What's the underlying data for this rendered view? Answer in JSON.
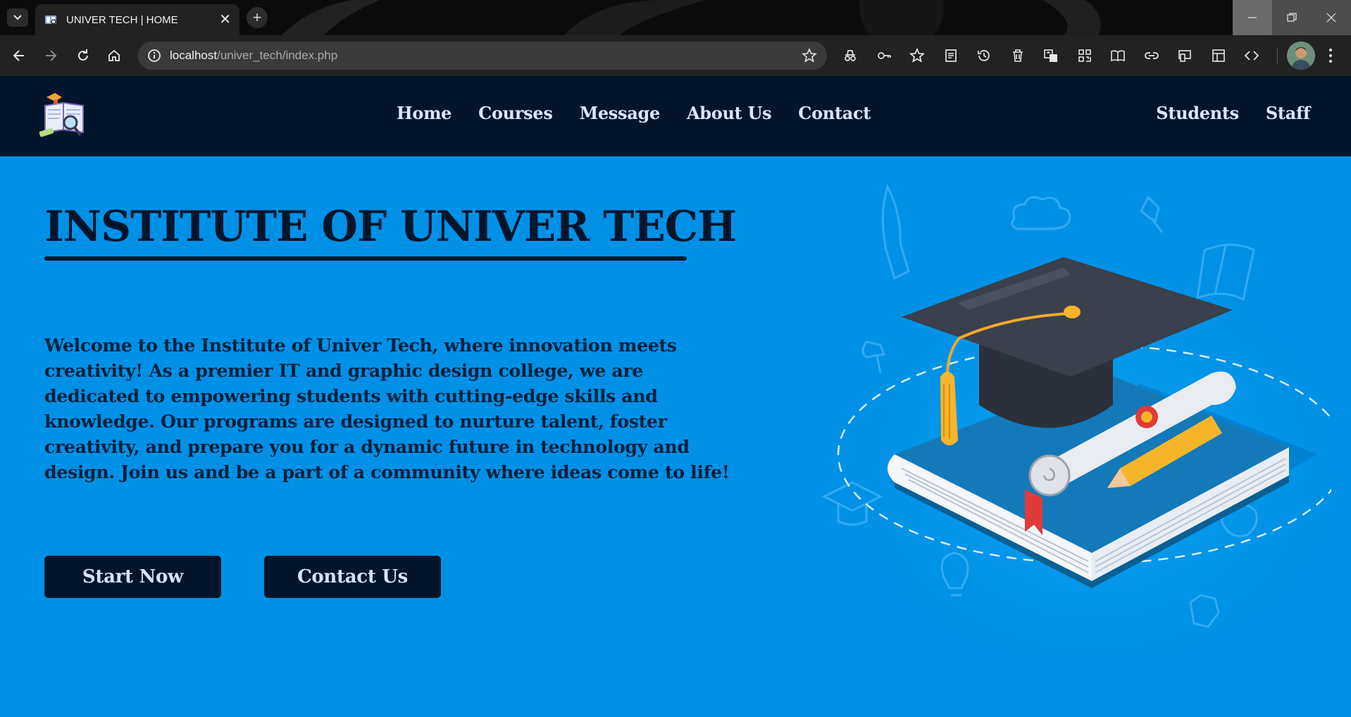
{
  "browser": {
    "tab_title": "UNIVER TECH | HOME",
    "tab_close": "✕",
    "new_tab": "+",
    "url_host": "localhost",
    "url_path": "/univer_tech/index.php"
  },
  "site": {
    "nav": {
      "links": [
        "Home",
        "Courses",
        "Message",
        "About Us",
        "Contact"
      ],
      "right_links": [
        "Students",
        "Staff"
      ]
    },
    "hero": {
      "title": "INSTITUTE OF UNIVER TECH",
      "paragraph": "Welcome to the Institute of Univer Tech, where innovation meets creativity! As a premier IT and graphic design college, we are dedicated to empowering students with cutting-edge skills and knowledge. Our programs are designed to nurture talent, foster creativity, and prepare you for a dynamic future in technology and design. Join us and be a part of a community where ideas come to life!",
      "buttons": {
        "start": "Start Now",
        "contact": "Contact Us"
      }
    }
  },
  "colors": {
    "hero_bg": "#0091e6",
    "navbar_bg": "#03152b",
    "nav_link": "#d6e8ff",
    "title": "#03152b"
  },
  "icons": [
    "tab-search-icon",
    "back-icon",
    "forward-icon",
    "reload-icon",
    "home-icon",
    "site-info-icon",
    "bookmark-star-icon",
    "incognito-icon",
    "password-key-icon",
    "favorites-icon",
    "reading-list-icon",
    "history-icon",
    "delete-icon",
    "translate-icon",
    "qr-code-icon",
    "reader-mode-icon",
    "link-icon",
    "cast-icon",
    "sidebar-icon",
    "devtools-icon",
    "profile-avatar",
    "menu-kebab-icon"
  ]
}
